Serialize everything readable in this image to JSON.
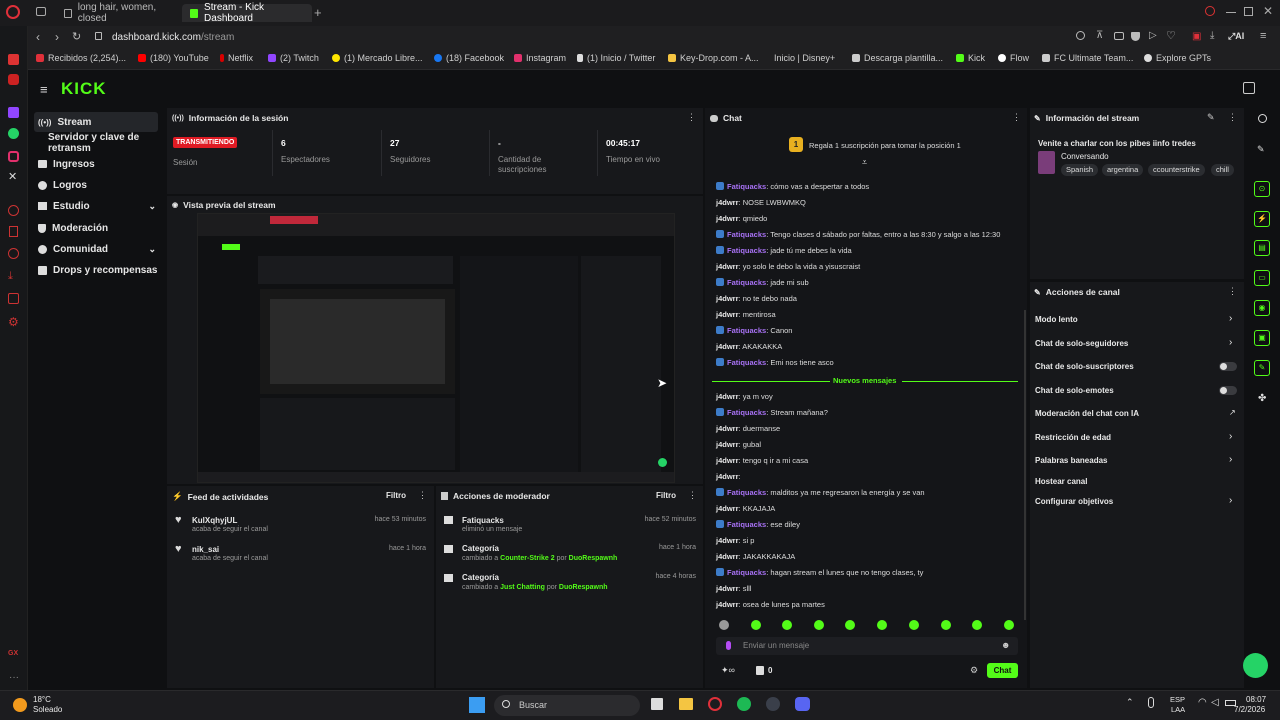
{
  "browser": {
    "tabs": [
      {
        "label": "long hair, women, closed"
      },
      {
        "label": "Stream - Kick Dashboard"
      }
    ],
    "url_host": "dashboard.kick.com",
    "url_path": "/stream",
    "bookmarks": [
      "Recibidos (2,254)...",
      "(180) YouTube",
      "Netflix",
      "(2) Twitch",
      "(1) Mercado Libre...",
      "(18) Facebook",
      "Instagram",
      "(1) Inicio / Twitter",
      "Key-Drop.com - A...",
      "Inicio | Disney+",
      "Descarga plantilla...",
      "Kick",
      "Flow",
      "FC Ultimate Team...",
      "Explore GPTs"
    ],
    "ai_label": "AI"
  },
  "kick": {
    "logo": "KICK",
    "nav": [
      {
        "label": "Stream"
      },
      {
        "label": "Servidor y clave de retransm"
      },
      {
        "label": "Ingresos"
      },
      {
        "label": "Logros"
      },
      {
        "label": "Estudio"
      },
      {
        "label": "Moderación"
      },
      {
        "label": "Comunidad"
      },
      {
        "label": "Drops y recompensas"
      }
    ]
  },
  "session": {
    "title": "Información de la sesión",
    "status_badge": "TRANSMITIENDO",
    "status_label": "Sesión",
    "viewers_value": "6",
    "viewers_label": "Espectadores",
    "followers_value": "27",
    "followers_label": "Seguidores",
    "subs_value": "-",
    "subs_label": "Cantidad de suscripciones",
    "live_value": "00:45:17",
    "live_label": "Tiempo en vivo"
  },
  "preview": {
    "title": "Vista previa del stream"
  },
  "feed": {
    "title": "Feed de actividades",
    "filter": "Filtro",
    "items": [
      {
        "name": "KulXqhyjUL",
        "sub": "acaba de seguir el canal",
        "time": "hace 53 minutos"
      },
      {
        "name": "nik_sai",
        "sub": "acaba de seguir el canal",
        "time": "hace 1 hora"
      }
    ]
  },
  "modactions": {
    "title": "Acciones de moderador",
    "filter": "Filtro",
    "items": [
      {
        "name": "Fatiquacks",
        "sub": "eliminó un mensaje",
        "time": "hace 52 minutos"
      },
      {
        "name": "Categoría",
        "sub_prefix": "cambiado a",
        "cat": "Counter-Strike 2",
        "por": "por",
        "user": "DuoRespawnh",
        "time": "hace 1 hora"
      },
      {
        "name": "Categoría",
        "sub_prefix": "cambiado a",
        "cat": "Just Chatting",
        "por": "por",
        "user": "DuoRespawnh",
        "time": "hace 4 horas"
      }
    ]
  },
  "chat": {
    "title": "Chat",
    "gift_text": "Regala 1 suscripción para tomar la posición 1",
    "gift_rank": "1",
    "new_messages": "Nuevos mensajes",
    "messages": [
      {
        "user": "Fatiquacks",
        "sep": ": ",
        "text": "cómo vas a despertar a todos",
        "badge": true
      },
      {
        "user": "j4dwrr",
        "sep": ": ",
        "text": "NOSE LWBWMKQ",
        "badge": false
      },
      {
        "user": "j4dwrr",
        "sep": ": ",
        "text": "qmiedo",
        "badge": false
      },
      {
        "user": "Fatiquacks",
        "sep": ": ",
        "text": "Tengo clases d sábado por faltas, entro a las 8:30 y salgo a las 12:30",
        "badge": true
      },
      {
        "user": "Fatiquacks",
        "sep": ": ",
        "text": "jade tú me debes la vida",
        "badge": true
      },
      {
        "user": "j4dwrr",
        "sep": ": ",
        "text": "yo solo le debo la vida a yisuscraist",
        "badge": false
      },
      {
        "user": "Fatiquacks",
        "sep": ": ",
        "text": "jade mi sub",
        "badge": true
      },
      {
        "user": "j4dwrr",
        "sep": ": ",
        "text": "no te debo nada",
        "badge": false
      },
      {
        "user": "j4dwrr",
        "sep": ": ",
        "text": "mentirosa",
        "badge": false
      },
      {
        "user": "Fatiquacks",
        "sep": ": ",
        "text": "Canon",
        "badge": true
      },
      {
        "user": "j4dwrr",
        "sep": ": ",
        "text": "AKAKAKKA",
        "badge": false
      },
      {
        "user": "Fatiquacks",
        "sep": ": ",
        "text": "Emi nos tiene asco",
        "badge": true
      }
    ],
    "messages_new": [
      {
        "user": "j4dwrr",
        "sep": ": ",
        "text": "ya m voy",
        "badge": false
      },
      {
        "user": "Fatiquacks",
        "sep": ": ",
        "text": "Stream mañana?",
        "badge": true
      },
      {
        "user": "j4dwrr",
        "sep": ": ",
        "text": "duermanse",
        "badge": false
      },
      {
        "user": "j4dwrr",
        "sep": ": ",
        "text": "gubal",
        "badge": false
      },
      {
        "user": "j4dwrr",
        "sep": ": ",
        "text": "tengo q ir a mi casa",
        "badge": false
      },
      {
        "user": "j4dwrr",
        "sep": ": ",
        "text": "",
        "badge": false
      },
      {
        "user": "Fatiquacks",
        "sep": ": ",
        "text": "malditos ya me regresaron la energía y se van",
        "badge": true
      },
      {
        "user": "j4dwrr",
        "sep": ": ",
        "text": "KKAJAJA",
        "badge": false
      },
      {
        "user": "Fatiquacks",
        "sep": ": ",
        "text": "ese diley",
        "badge": true
      },
      {
        "user": "j4dwrr",
        "sep": ": ",
        "text": "si p",
        "badge": false
      },
      {
        "user": "j4dwrr",
        "sep": ": ",
        "text": "JAKAKKAKAJA",
        "badge": false
      },
      {
        "user": "Fatiquacks",
        "sep": ": ",
        "text": "hagan stream el lunes que no tengo clases, ty",
        "badge": true
      },
      {
        "user": "j4dwrr",
        "sep": ": ",
        "text": "slll",
        "badge": false
      },
      {
        "user": "j4dwrr",
        "sep": ": ",
        "text": "osea de lunes pa martes",
        "badge": false
      }
    ],
    "input_placeholder": "Enviar un mensaje",
    "points": "0",
    "send": "Chat"
  },
  "streaminfo": {
    "title": "Información del stream",
    "stream_title": "Venite a charlar con los pibes iinfo tredes",
    "category": "Conversando",
    "tags": [
      "Spanish",
      "argentina",
      "ccounterstrike",
      "chill"
    ]
  },
  "channel": {
    "title": "Acciones de canal",
    "actions": [
      {
        "label": "Modo lento",
        "kind": "chev"
      },
      {
        "label": "Chat de solo-seguidores",
        "kind": "chev"
      },
      {
        "label": "Chat de solo-suscriptores",
        "kind": "toggle"
      },
      {
        "label": "Chat de solo-emotes",
        "kind": "toggle"
      },
      {
        "label": "Moderación del chat con IA",
        "kind": "ext"
      },
      {
        "label": "Restricción de edad",
        "kind": "chev"
      },
      {
        "label": "Palabras baneadas",
        "kind": "chev"
      },
      {
        "label": "Hostear canal",
        "kind": "none"
      },
      {
        "label": "Configurar objetivos",
        "kind": "chev"
      }
    ]
  },
  "taskbar": {
    "weather_temp": "18°C",
    "weather_desc": "Soleado",
    "search": "Buscar",
    "lang1": "ESP",
    "lang2": "LAA",
    "time": "08:07",
    "date": "7/2/2026"
  },
  "colors": {
    "kick_green": "#53fc18",
    "live_red": "#e01b24",
    "user_purple": "#a872f5"
  }
}
